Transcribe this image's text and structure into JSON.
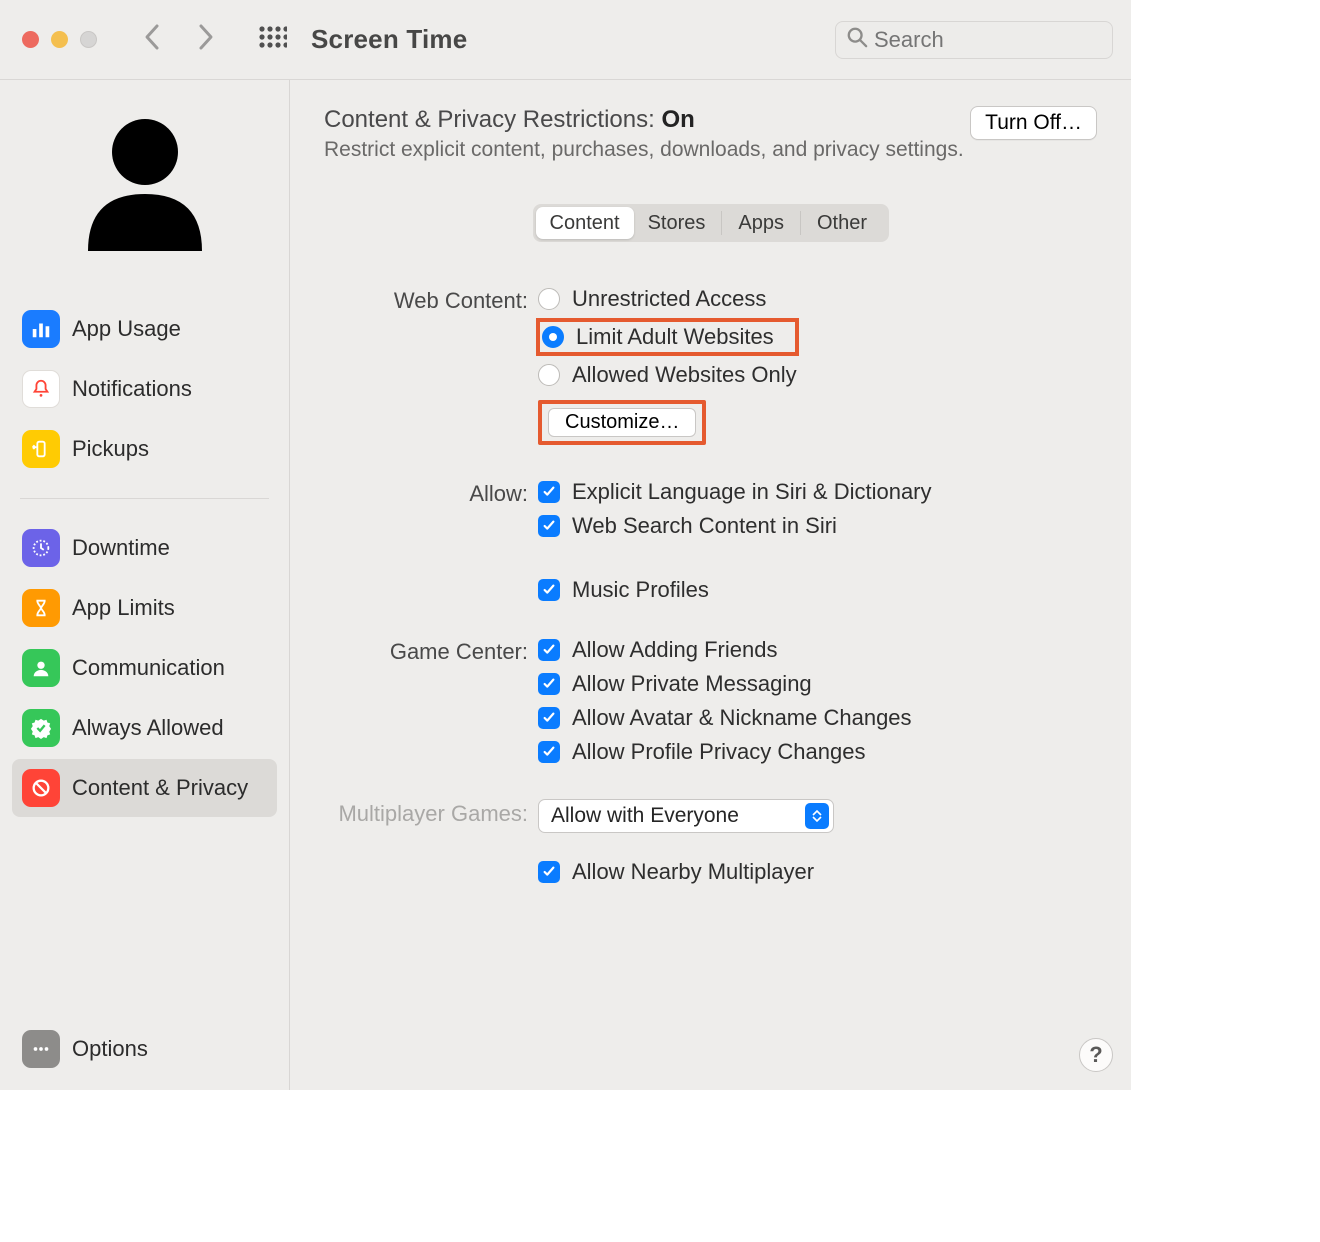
{
  "window": {
    "title": "Screen Time",
    "search_placeholder": "Search"
  },
  "sidebar": {
    "items": [
      {
        "label": "App Usage"
      },
      {
        "label": "Notifications"
      },
      {
        "label": "Pickups"
      },
      {
        "label": "Downtime"
      },
      {
        "label": "App Limits"
      },
      {
        "label": "Communication"
      },
      {
        "label": "Always Allowed"
      },
      {
        "label": "Content & Privacy"
      },
      {
        "label": "Options"
      }
    ]
  },
  "main": {
    "header_prefix": "Content & Privacy Restrictions: ",
    "header_status": "On",
    "header_sub": "Restrict explicit content, purchases, downloads, and privacy settings.",
    "turn_off": "Turn Off…",
    "tabs": {
      "content": "Content",
      "stores": "Stores",
      "apps": "Apps",
      "other": "Other"
    },
    "web_content_label": "Web Content:",
    "web_content": {
      "unrestricted": "Unrestricted Access",
      "limit": "Limit Adult Websites",
      "allowed": "Allowed Websites Only",
      "customize": "Customize…"
    },
    "allow_label": "Allow:",
    "allow": {
      "siri_lang": "Explicit Language in Siri & Dictionary",
      "siri_web": "Web Search Content in Siri",
      "music": "Music Profiles"
    },
    "gc_label": "Game Center:",
    "gc": {
      "friends": "Allow Adding Friends",
      "pm": "Allow Private Messaging",
      "avatar": "Allow Avatar & Nickname Changes",
      "profile": "Allow Profile Privacy Changes"
    },
    "mp_label": "Multiplayer Games:",
    "mp": {
      "select": "Allow with Everyone",
      "nearby": "Allow Nearby Multiplayer"
    },
    "help": "?"
  }
}
